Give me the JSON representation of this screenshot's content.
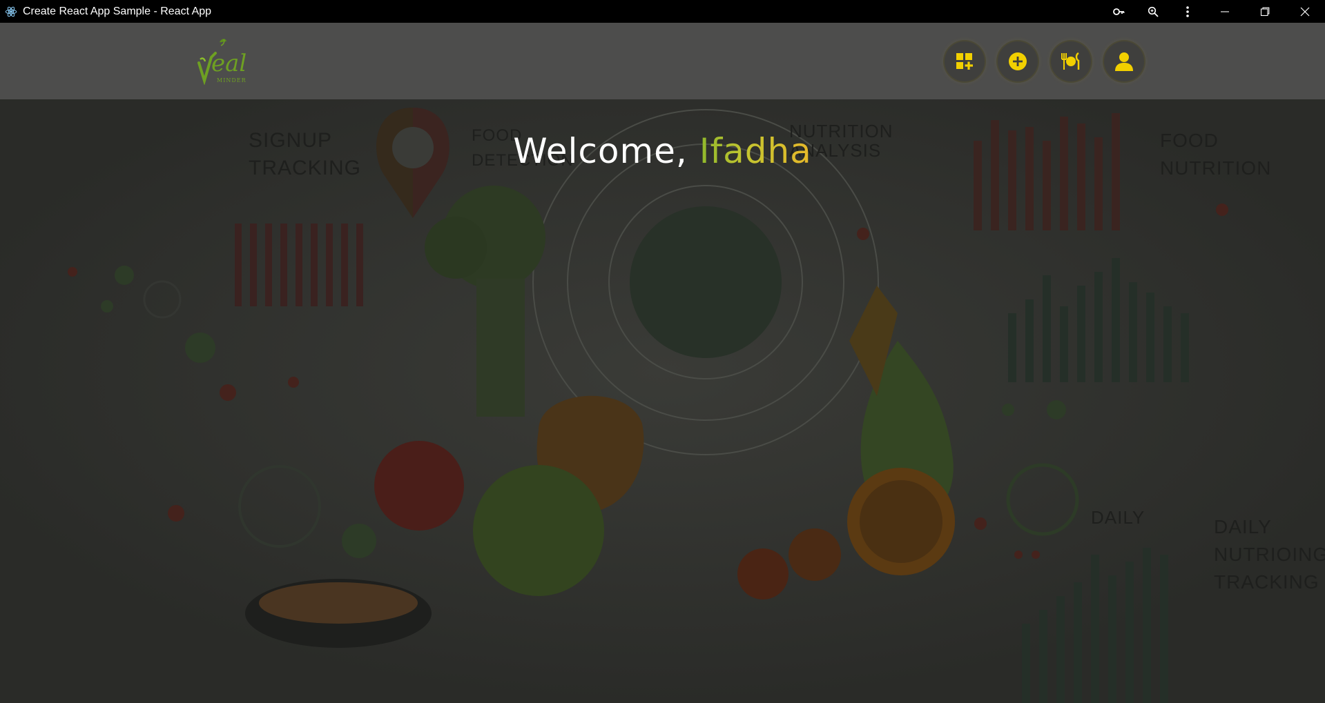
{
  "window": {
    "title": "Create React App Sample - React App",
    "controls": [
      "key-icon",
      "zoom-icon",
      "more-icon",
      "minimize-icon",
      "maximize-icon",
      "close-icon"
    ]
  },
  "header": {
    "logo_alt": "Meal Minder",
    "nav": [
      {
        "icon": "dashboard-add-icon"
      },
      {
        "icon": "add-circle-icon"
      },
      {
        "icon": "meal-icon"
      },
      {
        "icon": "profile-icon"
      }
    ],
    "accent_color": "#f2d000"
  },
  "hero": {
    "welcome_prefix": "Welcome, ",
    "user_name": "Ifadha",
    "background_labels": {
      "signup_tracking": "SIGNUP\nTRACKING",
      "food_detection": "FOOD\nDETECTION",
      "nutrition_analysis": "NUTRITION\nANALYSIS",
      "food_nutrition": "FOOD\nNUTRITION",
      "daily": "DAILY",
      "daily_nutrition_tracking": "DAILY\nNUTRIOING\nTRACKING"
    }
  }
}
